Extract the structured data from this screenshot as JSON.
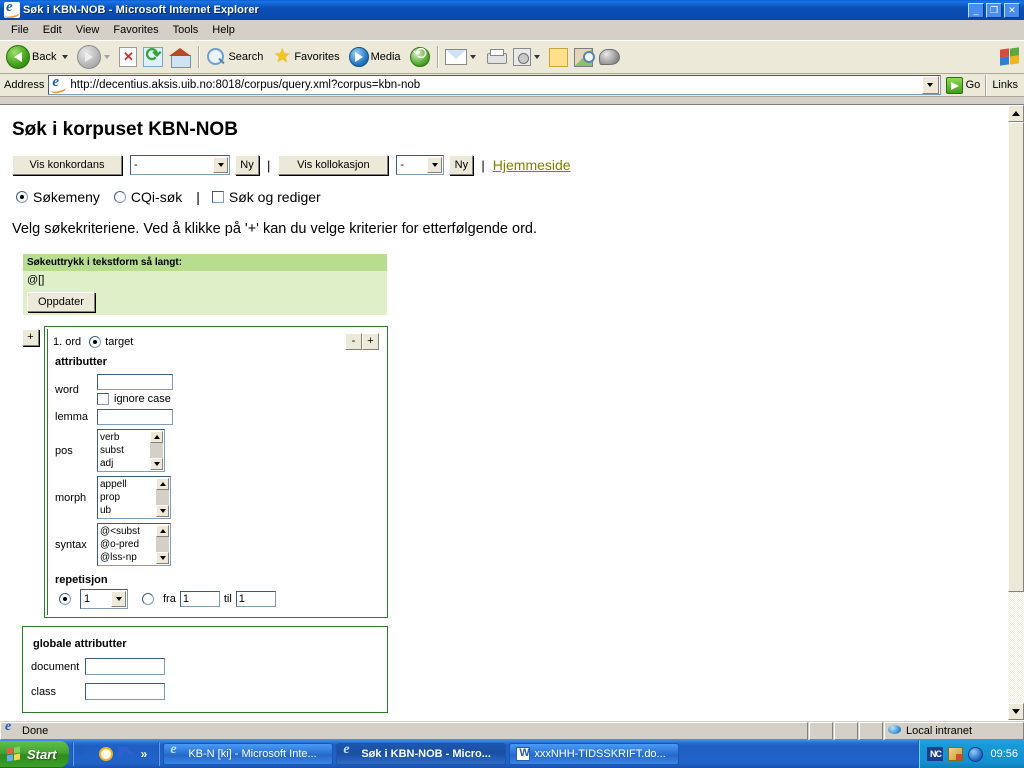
{
  "window": {
    "title": "Søk i KBN-NOB - Microsoft Internet Explorer",
    "minimize_label": "_",
    "restore_label": "❐",
    "close_label": "✕"
  },
  "menu": {
    "items": [
      "File",
      "Edit",
      "View",
      "Favorites",
      "Tools",
      "Help"
    ]
  },
  "toolbar": {
    "back_label": "Back",
    "forward_label": "",
    "stop_label": "",
    "refresh_label": "",
    "home_label": "",
    "search_label": "Search",
    "favorites_label": "Favorites",
    "media_label": "Media",
    "history_label": ""
  },
  "address": {
    "label": "Address",
    "url": "http://decentius.aksis.uib.no:8018/corpus/query.xml?corpus=kbn-nob",
    "go_label": "Go",
    "links_label": "Links"
  },
  "page": {
    "title": "Søk i korpuset KBN-NOB",
    "actions": {
      "konkordans_button": "Vis konkordans",
      "konkordans_select": "-",
      "konkordans_ny": "Ny",
      "separator": "|",
      "kollokasjon_button": "Vis kollokasjon",
      "kollokasjon_select": "-",
      "kollokasjon_ny": "Ny",
      "separator2": "|",
      "home_link": "Hjemmeside"
    },
    "modes": {
      "sokemeny": "Søkemeny",
      "cqi": "CQi-søk",
      "pipe": "|",
      "edit": "Søk og rediger"
    },
    "instruction": "Velg søkekriteriene. Ved å klikke på '+' kan du velge kriterier for etterfølgende ord.",
    "expression": {
      "header": "Søkeuttrykk i tekstform så langt:",
      "value": "@[]",
      "update_button": "Oppdater"
    },
    "word_block": {
      "add_before_button": "+",
      "ord_label": "1. ord",
      "target_label": "target",
      "remove_button": "-",
      "add_button": "+",
      "attributes_title": "attributter",
      "word_label": "word",
      "word_value": "",
      "ignore_case_label": "ignore case",
      "lemma_label": "lemma",
      "lemma_value": "",
      "pos_label": "pos",
      "pos_options": [
        "verb",
        "subst",
        "adj"
      ],
      "morph_label": "morph",
      "morph_options": [
        "appell",
        "prop",
        "ub"
      ],
      "syntax_label": "syntax",
      "syntax_options": [
        "@<subst",
        "@o-pred",
        "@lss-np"
      ],
      "repetition_title": "repetisjon",
      "repetition_count": "1",
      "from_label": "fra",
      "from_value": "1",
      "to_label": "til",
      "to_value": "1"
    },
    "global_attributes": {
      "title": "globale attributter",
      "document_label": "document",
      "document_value": "",
      "class_label": "class",
      "class_value": ""
    }
  },
  "status": {
    "message": "Done",
    "zone": "Local intranet"
  },
  "taskbar": {
    "start_label": "Start",
    "overflow_label": "»",
    "tasks": [
      {
        "label": "KB-N [ki] - Microsoft Inte...",
        "icon": "ie-icon",
        "active": false
      },
      {
        "label": "Søk i KBN-NOB - Micro...",
        "icon": "ie-icon",
        "active": true
      },
      {
        "label": "xxxNHH-TIDSSKRIFT.do...",
        "icon": "word-icon",
        "active": false
      }
    ],
    "tray_nc": "NC",
    "clock": "09:56"
  }
}
